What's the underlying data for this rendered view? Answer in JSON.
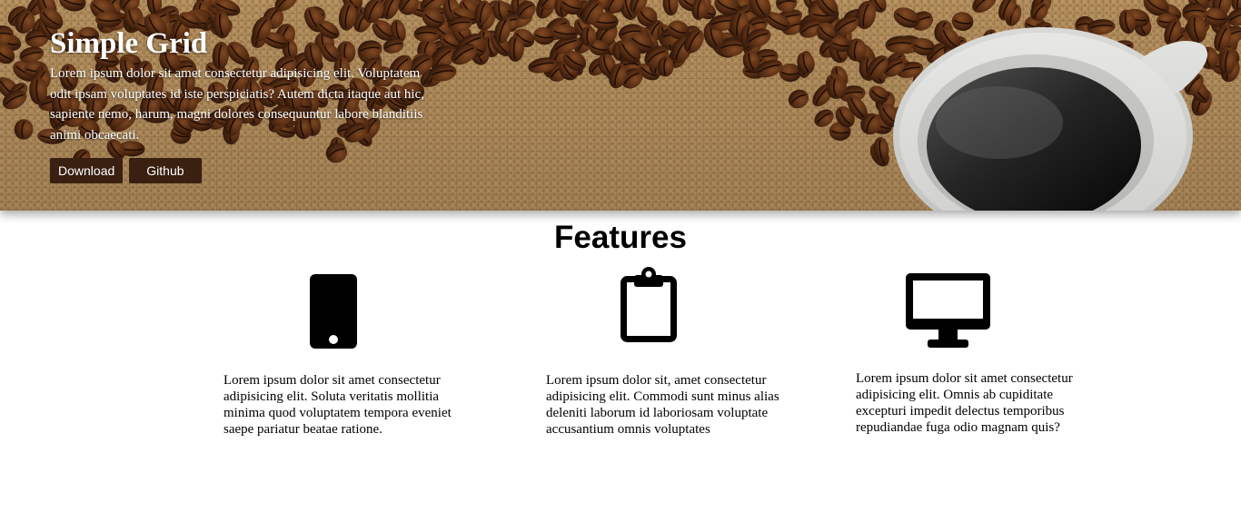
{
  "hero": {
    "title": "Simple Grid",
    "description": "Lorem ipsum dolor sit amet consectetur adipisicing elit. Voluptatem odit ipsam voluptates id iste perspiciatis? Autem dicta itaque aut hic, sapiente nemo, harum, magni dolores consequuntur labore blanditiis animi obcaecati.",
    "buttons": [
      {
        "label": "Download"
      },
      {
        "label": "Github"
      }
    ],
    "image": "coffee-beans-and-cup-photo"
  },
  "features": {
    "title": "Features",
    "items": [
      {
        "icon": "mobile-phone-icon",
        "text": "Lorem ipsum dolor sit amet consectetur adipisicing elit. Soluta veritatis mollitia minima quod voluptatem tempora eveniet saepe pariatur beatae ratione."
      },
      {
        "icon": "clipboard-icon",
        "text": "Lorem ipsum dolor sit, amet consectetur adipisicing elit. Commodi sunt minus alias deleniti laborum id laboriosam voluptate accusantium omnis voluptates"
      },
      {
        "icon": "desktop-monitor-icon",
        "text": "Lorem ipsum dolor sit amet consectetur adipisicing elit. Omnis ab cupiditate excepturi impedit delectus temporibus repudiandae fuga odio magnam quis?"
      }
    ]
  },
  "colors": {
    "button_bg": "#3a2011",
    "button_text": "#ffffff",
    "icon": "#000000"
  }
}
